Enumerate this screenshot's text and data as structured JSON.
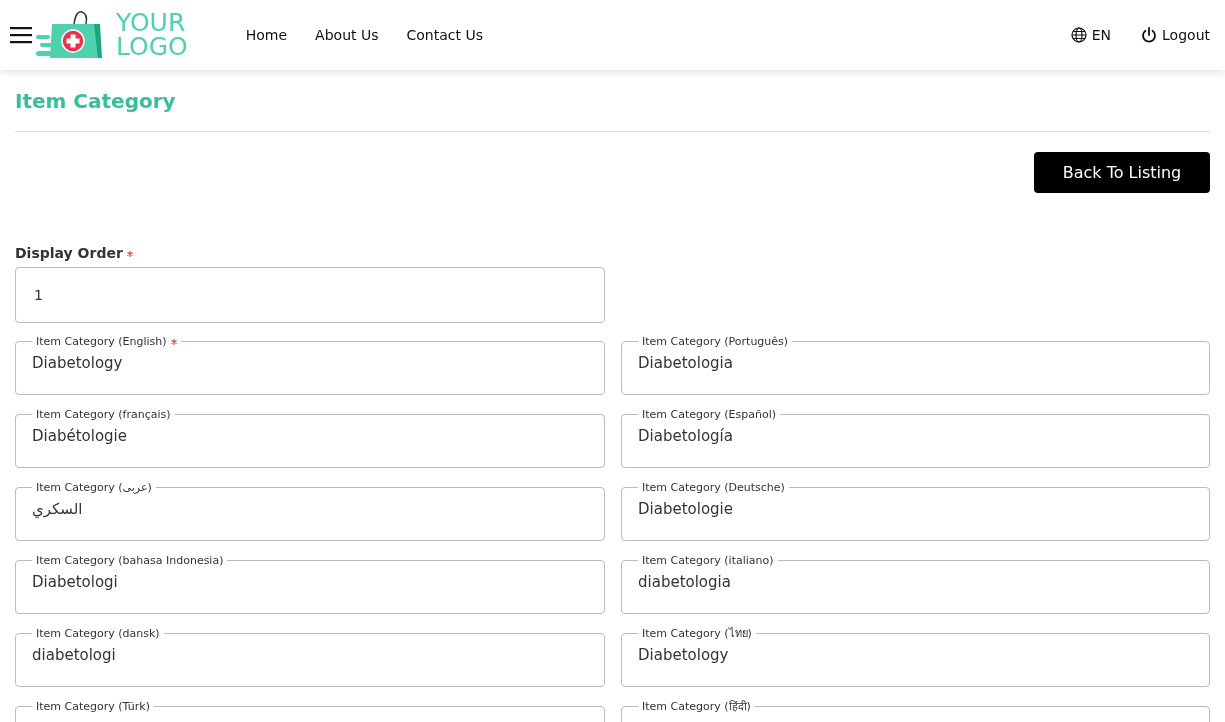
{
  "header": {
    "logo": {
      "line1": "YOUR",
      "line2": "LOGO"
    },
    "nav": [
      "Home",
      "About Us",
      "Contact Us"
    ],
    "language": "EN",
    "logout": "Logout"
  },
  "page_title": "Item Category",
  "back_button": "Back To Listing",
  "display_order": {
    "label": "Display Order",
    "required": true,
    "value": "1"
  },
  "fields": [
    {
      "label": "Item Category (English)",
      "required": true,
      "value": "Diabetology"
    },
    {
      "label": "Item Category (Português)",
      "required": false,
      "value": "Diabetologia"
    },
    {
      "label": "Item Category (français)",
      "required": false,
      "value": "Diabétologie"
    },
    {
      "label": "Item Category (Español)",
      "required": false,
      "value": "Diabetología"
    },
    {
      "label": "Item Category (عربى)",
      "required": false,
      "value": "السكري"
    },
    {
      "label": "Item Category (Deutsche)",
      "required": false,
      "value": "Diabetologie"
    },
    {
      "label": "Item Category (bahasa Indonesia)",
      "required": false,
      "value": "Diabetologi"
    },
    {
      "label": "Item Category (italiano)",
      "required": false,
      "value": "diabetologia"
    },
    {
      "label": "Item Category (dansk)",
      "required": false,
      "value": "diabetologi"
    },
    {
      "label": "Item Category (ไทย)",
      "required": false,
      "value": "Diabetology"
    },
    {
      "label": "Item Category (Türk)",
      "required": false
    },
    {
      "label": "Item Category (हिंदी)",
      "required": false
    }
  ]
}
